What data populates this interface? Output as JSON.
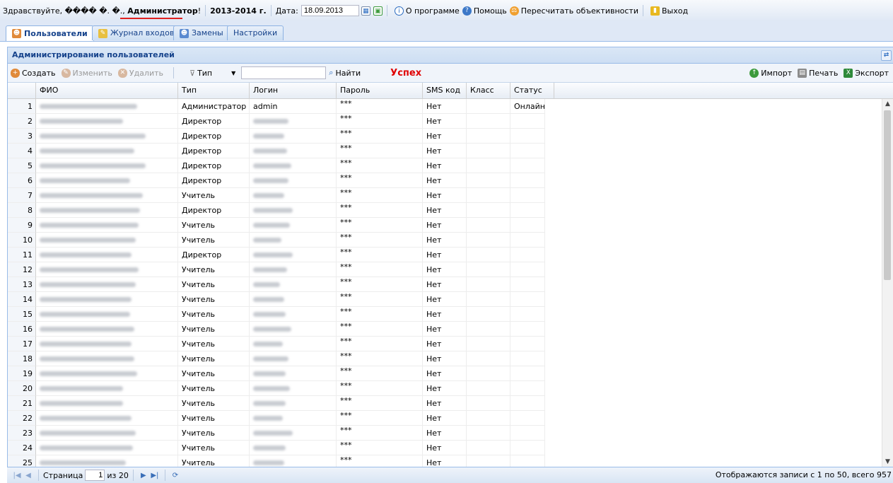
{
  "top": {
    "greeting": "Здравствуйте, ���� �. �., ",
    "role": "Администратор",
    "role_suffix": "!",
    "year": "2013-2014 г.",
    "date_label": "Дата:",
    "date_value": "18.09.2013",
    "about": "О программе",
    "help": "Помощь",
    "recalc": "Пересчитать объективности",
    "logout": "Выход"
  },
  "tabs": [
    "Пользователи",
    "Журнал входов",
    "Замены",
    "Настройки"
  ],
  "panel_title": "Администрирование пользователей",
  "toolbar": {
    "create": "Создать",
    "edit": "Изменить",
    "delete": "Удалить",
    "type_filter": "Тип",
    "search_value": "",
    "find": "Найти",
    "status": "Успех",
    "import": "Импорт",
    "print": "Печать",
    "export": "Экспорт"
  },
  "columns": [
    "ФИО",
    "Тип",
    "Логин",
    "Пароль",
    "SMS код",
    "Класс",
    "Статус"
  ],
  "rows": [
    {
      "n": "1",
      "type": "Администратор",
      "login": "admin",
      "password": "***",
      "sms": "Нет",
      "status": "Онлайн"
    },
    {
      "n": "2",
      "type": "Директор",
      "login": "",
      "password": "***",
      "sms": "Нет",
      "status": ""
    },
    {
      "n": "3",
      "type": "Директор",
      "login": "",
      "password": "***",
      "sms": "Нет",
      "status": ""
    },
    {
      "n": "4",
      "type": "Директор",
      "login": "",
      "password": "***",
      "sms": "Нет",
      "status": ""
    },
    {
      "n": "5",
      "type": "Директор",
      "login": "",
      "password": "***",
      "sms": "Нет",
      "status": ""
    },
    {
      "n": "6",
      "type": "Директор",
      "login": "",
      "password": "***",
      "sms": "Нет",
      "status": ""
    },
    {
      "n": "7",
      "type": "Учитель",
      "login": "",
      "password": "***",
      "sms": "Нет",
      "status": ""
    },
    {
      "n": "8",
      "type": "Директор",
      "login": "",
      "password": "***",
      "sms": "Нет",
      "status": ""
    },
    {
      "n": "9",
      "type": "Учитель",
      "login": "",
      "password": "***",
      "sms": "Нет",
      "status": ""
    },
    {
      "n": "10",
      "type": "Учитель",
      "login": "",
      "password": "***",
      "sms": "Нет",
      "status": ""
    },
    {
      "n": "11",
      "type": "Директор",
      "login": "",
      "password": "***",
      "sms": "Нет",
      "status": ""
    },
    {
      "n": "12",
      "type": "Учитель",
      "login": "",
      "password": "***",
      "sms": "Нет",
      "status": ""
    },
    {
      "n": "13",
      "type": "Учитель",
      "login": "",
      "password": "***",
      "sms": "Нет",
      "status": ""
    },
    {
      "n": "14",
      "type": "Учитель",
      "login": "",
      "password": "***",
      "sms": "Нет",
      "status": ""
    },
    {
      "n": "15",
      "type": "Учитель",
      "login": "",
      "password": "***",
      "sms": "Нет",
      "status": ""
    },
    {
      "n": "16",
      "type": "Учитель",
      "login": "",
      "password": "***",
      "sms": "Нет",
      "status": ""
    },
    {
      "n": "17",
      "type": "Учитель",
      "login": "",
      "password": "***",
      "sms": "Нет",
      "status": ""
    },
    {
      "n": "18",
      "type": "Учитель",
      "login": "",
      "password": "***",
      "sms": "Нет",
      "status": ""
    },
    {
      "n": "19",
      "type": "Учитель",
      "login": "",
      "password": "***",
      "sms": "Нет",
      "status": ""
    },
    {
      "n": "20",
      "type": "Учитель",
      "login": "",
      "password": "***",
      "sms": "Нет",
      "status": ""
    },
    {
      "n": "21",
      "type": "Учитель",
      "login": "",
      "password": "***",
      "sms": "Нет",
      "status": ""
    },
    {
      "n": "22",
      "type": "Учитель",
      "login": "",
      "password": "***",
      "sms": "Нет",
      "status": ""
    },
    {
      "n": "23",
      "type": "Учитель",
      "login": "",
      "password": "***",
      "sms": "Нет",
      "status": ""
    },
    {
      "n": "24",
      "type": "Учитель",
      "login": "",
      "password": "***",
      "sms": "Нет",
      "status": ""
    },
    {
      "n": "25",
      "type": "Учитель",
      "login": "",
      "password": "***",
      "sms": "Нет",
      "status": ""
    }
  ],
  "pager": {
    "page_label": "Страница",
    "page_value": "1",
    "of_label": "из 20",
    "info": "Отображаются записи с 1 по 50, всего 957"
  },
  "colors": {
    "accent": "#15428b",
    "border": "#99bbe8",
    "success": "#e00000"
  }
}
